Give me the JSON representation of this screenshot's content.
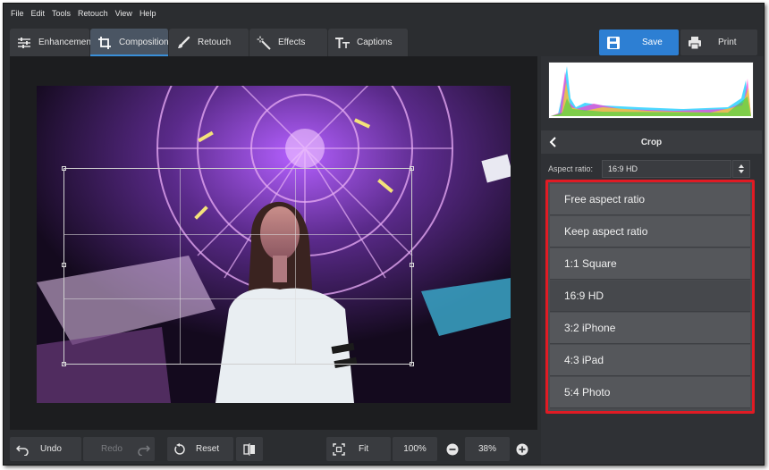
{
  "menu": [
    "File",
    "Edit",
    "Tools",
    "Retouch",
    "View",
    "Help"
  ],
  "tabs": [
    {
      "label": "Enhancement",
      "icon": "sliders-icon"
    },
    {
      "label": "Composition",
      "icon": "crop-icon",
      "active": true
    },
    {
      "label": "Retouch",
      "icon": "brush-icon"
    },
    {
      "label": "Effects",
      "icon": "magic-wand-icon"
    },
    {
      "label": "Captions",
      "icon": "text-icon"
    }
  ],
  "actions": {
    "save": "Save",
    "print": "Print"
  },
  "crop_panel": {
    "title": "Crop",
    "aspect_label": "Aspect ratio:",
    "aspect_value": "16:9 HD",
    "options": [
      "Free aspect ratio",
      "Keep aspect ratio",
      "1:1 Square",
      "16:9 HD",
      "3:2 iPhone",
      "4:3 iPad",
      "5:4 Photo"
    ],
    "selected_index": 3
  },
  "bottom": {
    "undo": "Undo",
    "redo": "Redo",
    "reset": "Reset",
    "fit": "Fit",
    "zoom_100": "100%",
    "zoom_value": "38%"
  },
  "colors": {
    "accent": "#2d7fd3",
    "highlight_border": "#e01b24"
  }
}
